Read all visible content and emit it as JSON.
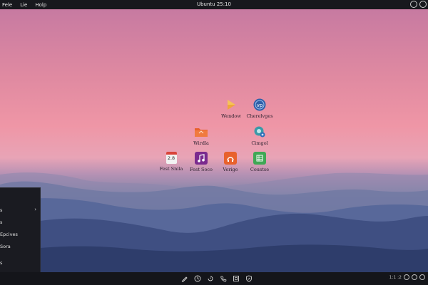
{
  "topbar": {
    "menu": [
      "Fele",
      "Lie",
      "Holp"
    ],
    "title": "Ubuntu 25:10"
  },
  "desktop": {
    "icons": [
      {
        "label": "Wendow",
        "icon": "play-icon",
        "color": "#f0a63a"
      },
      {
        "label": "Cherelvges",
        "icon": "vscode-icon",
        "color": "#2f5fa8"
      },
      {
        "label": "Wirdla",
        "icon": "folder-icon",
        "color": "#e8612c"
      },
      {
        "label": "Cimgol",
        "icon": "settings-icon",
        "color": "#3a9aa8"
      },
      {
        "label": "Fest Snila",
        "icon": "calendar-icon",
        "color": "#f2f2f2"
      },
      {
        "label": "Fest Soco",
        "icon": "music-icon",
        "color": "#7a2a8e"
      },
      {
        "label": "Verige",
        "icon": "software-icon",
        "color": "#e8612c"
      },
      {
        "label": "Coustse",
        "icon": "spreadsheet-icon",
        "color": "#3fa855"
      }
    ],
    "calendar_number": "2.8"
  },
  "side_menu": {
    "items": [
      {
        "label": "s",
        "has_submenu": true
      },
      {
        "label": "s",
        "has_submenu": false
      },
      {
        "label": "Epcives",
        "has_submenu": false
      },
      {
        "label": "Sora",
        "has_submenu": false
      },
      {
        "label": "s",
        "has_submenu": false
      }
    ],
    "chevron": "›"
  },
  "taskbar": {
    "icons": [
      "pen-icon",
      "clock-icon",
      "history-icon",
      "phone-icon",
      "window-icon",
      "shield-icon"
    ],
    "tray_text": "1:1 :2"
  },
  "colors": {
    "topbar": "#17181d",
    "taskbar": "#14151a",
    "accent_orange": "#e8612c"
  }
}
